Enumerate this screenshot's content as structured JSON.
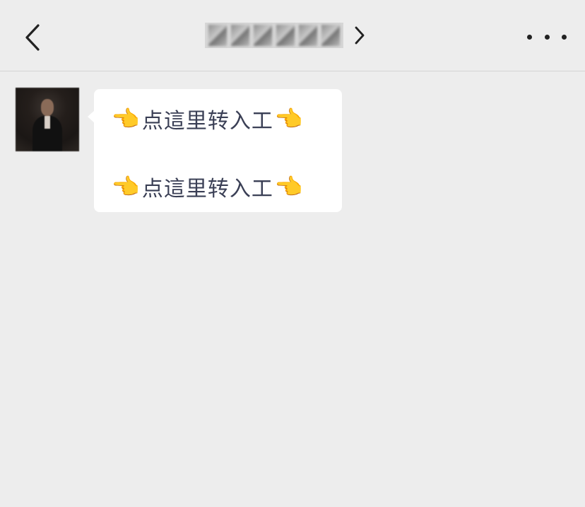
{
  "nav": {
    "title": "",
    "back_icon": "chevron-left-icon",
    "title_chevron_icon": "chevron-right-icon",
    "more_icon": "more-dots-icon"
  },
  "chat": {
    "avatar": "contact-avatar",
    "message": {
      "lines": [
        {
          "emoji_left": "👉",
          "text": "点這里转入工",
          "emoji_right": "👈"
        },
        {
          "emoji_left": "👉",
          "text": "点這里转入工",
          "emoji_right": "👈"
        }
      ]
    }
  },
  "colors": {
    "background": "#ededed",
    "bubble": "#ffffff",
    "text": "#3a3f55",
    "divider": "#d4d4d4"
  }
}
